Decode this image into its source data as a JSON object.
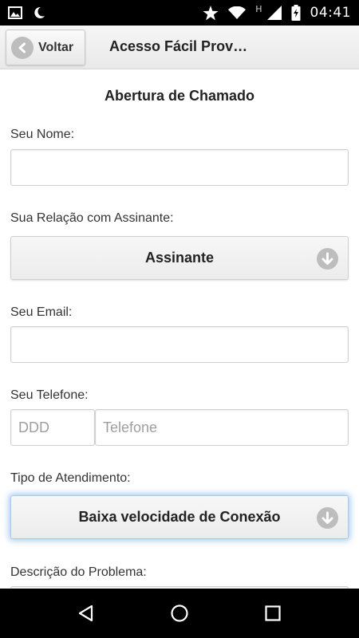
{
  "status_bar": {
    "time": "04:41",
    "network_letter": "H",
    "icons": [
      "image-icon",
      "moon-icon",
      "star-icon",
      "wifi-icon",
      "network-type-icon",
      "signal-icon",
      "battery-icon"
    ]
  },
  "header": {
    "back_label": "Voltar",
    "title": "Acesso Fácil Prov…"
  },
  "form": {
    "title": "Abertura de Chamado",
    "name_label": "Seu Nome:",
    "name_value": "",
    "relation_label": "Sua Relação com Assinante:",
    "relation_value": "Assinante",
    "email_label": "Seu Email:",
    "email_value": "",
    "phone_label": "Seu Telefone:",
    "ddd_placeholder": "DDD",
    "phone_placeholder": "Telefone",
    "service_type_label": "Tipo de Atendimento:",
    "service_type_value": "Baixa velocidade de Conexão",
    "description_label": "Descrição do Problema:"
  },
  "nav": {
    "icons": [
      "back-triangle-icon",
      "home-circle-icon",
      "recents-square-icon"
    ]
  }
}
